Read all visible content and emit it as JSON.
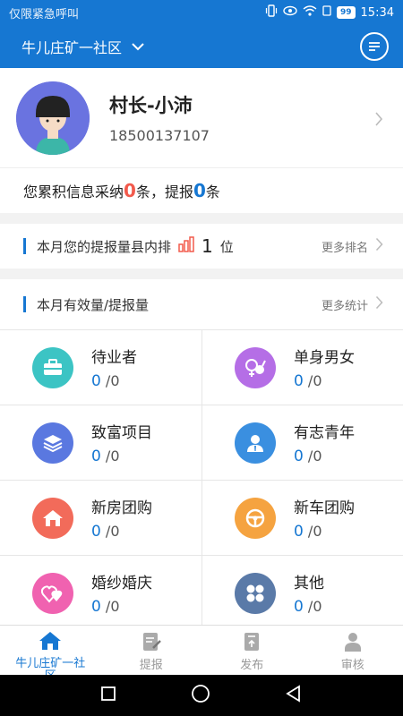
{
  "status_bar": {
    "left_text": "仅限紧急呼叫",
    "battery": "99",
    "time": "15:34"
  },
  "header": {
    "community": "牛儿庄矿一社区"
  },
  "profile": {
    "name": "村长-小沛",
    "phone": "18500137107"
  },
  "summary": {
    "prefix": "您累积信息采纳",
    "adopted": "0",
    "middle": "条，提报",
    "reported": "0",
    "suffix": "条"
  },
  "rank": {
    "label": "本月您的提报量县内排",
    "value": "1",
    "unit": "位",
    "more": "更多排名"
  },
  "stats": {
    "label": "本月有效量/提报量",
    "more": "更多统计"
  },
  "categories": [
    {
      "label": "待业者",
      "valid": "0",
      "total": "/0",
      "icon": "briefcase-icon",
      "color": "#3cc4c4"
    },
    {
      "label": "单身男女",
      "valid": "0",
      "total": "/0",
      "icon": "couple-icon",
      "color": "#b56ee6"
    },
    {
      "label": "致富项目",
      "valid": "0",
      "total": "/0",
      "icon": "layers-icon",
      "color": "#5a78e0"
    },
    {
      "label": "有志青年",
      "valid": "0",
      "total": "/0",
      "icon": "person-icon",
      "color": "#3a8fe0"
    },
    {
      "label": "新房团购",
      "valid": "0",
      "total": "/0",
      "icon": "house-icon",
      "color": "#f26b5a"
    },
    {
      "label": "新车团购",
      "valid": "0",
      "total": "/0",
      "icon": "steering-wheel-icon",
      "color": "#f5a340"
    },
    {
      "label": "婚纱婚庆",
      "valid": "0",
      "total": "/0",
      "icon": "hearts-icon",
      "color": "#f062b0"
    },
    {
      "label": "其他",
      "valid": "0",
      "total": "/0",
      "icon": "grid-icon",
      "color": "#5a7aa8"
    }
  ],
  "tabs": [
    {
      "label": "牛儿庄矿一社区",
      "icon": "home-icon"
    },
    {
      "label": "提报",
      "icon": "edit-icon"
    },
    {
      "label": "发布",
      "icon": "publish-icon"
    },
    {
      "label": "审核",
      "icon": "review-icon"
    }
  ],
  "colors": {
    "primary": "#1677d2",
    "accent_red": "#f25a4c"
  }
}
